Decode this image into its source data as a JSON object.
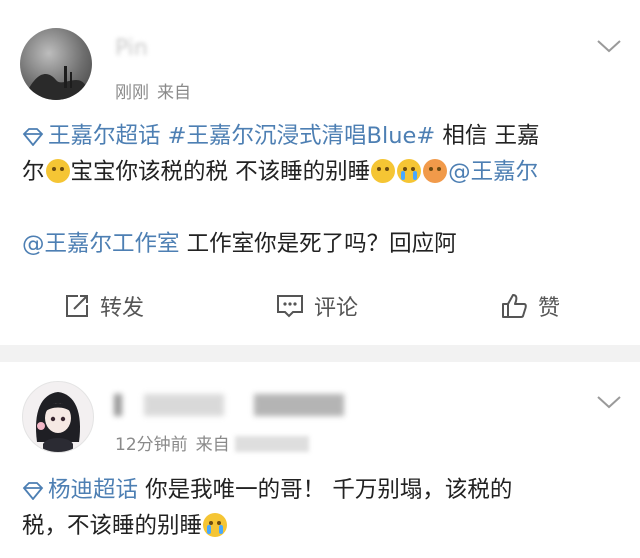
{
  "post1": {
    "nickname": "Pin",
    "time": "刚刚",
    "source": "来自",
    "topic1": "王嘉尔超话",
    "hashtag": "#王嘉尔沉浸式清唱Blue#",
    "text_a": " 相信 王嘉",
    "text_b": "尔",
    "text_c": "宝宝你该税的税 不该睡的别睡",
    "mention1": "@王嘉尔",
    "mention2": "@王嘉尔工作室",
    "text_d": " 工作室你是死了吗？回应阿",
    "repost_label": "转发",
    "comment_label": "评论",
    "like_label": "赞"
  },
  "post2": {
    "nickname": "",
    "time": "12分钟前",
    "source": "来自",
    "topic": "杨迪超话",
    "text_a": " 你是我唯一的哥！ 千万别塌，该税的",
    "text_b": "税，不该睡的别睡"
  },
  "icons": [
    "chevron-down-icon",
    "topic-diamond-icon",
    "repost-icon",
    "comment-icon",
    "like-icon"
  ],
  "colors": {
    "link": "#4d7fb3",
    "meta": "#8a8a8a",
    "separator": "#f2f2f2"
  }
}
